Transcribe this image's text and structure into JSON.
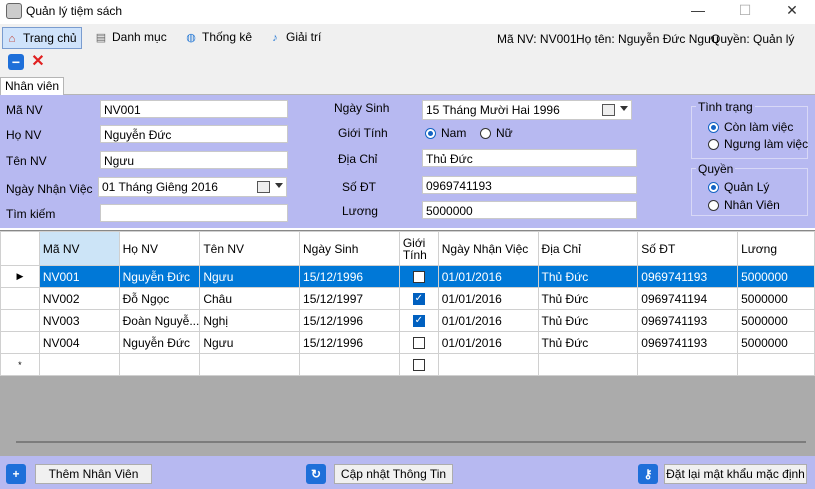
{
  "window": {
    "title": "Quản lý tiệm sách",
    "minimize": "—",
    "maximize": "☐",
    "close": "✕"
  },
  "menu": {
    "items": [
      {
        "label": "Trang chủ",
        "icon": "home-icon"
      },
      {
        "label": "Danh mục",
        "icon": "document-icon"
      },
      {
        "label": "Thống kê",
        "icon": "globe-icon"
      },
      {
        "label": "Giải trí",
        "icon": "music-note-icon"
      }
    ],
    "user": {
      "ma_nv": "Mã NV: NV001",
      "ho_ten": "Họ tên: Nguyễn Đức Ngưu",
      "quyen": "Quyền: Quản lý"
    }
  },
  "toolbar": {
    "minimize_glyph": "−",
    "close_glyph": "✕"
  },
  "tab": {
    "label": "Nhân viên"
  },
  "form": {
    "ma_nv": {
      "label": "Mã NV",
      "value": "NV001"
    },
    "ho_nv": {
      "label": "Họ NV",
      "value": "Nguyễn Đức"
    },
    "ten_nv": {
      "label": "Tên NV",
      "value": "Ngưu"
    },
    "ngay_nhan_viec": {
      "label": "Ngày Nhận Việc",
      "value": "01   Tháng Giêng   2016"
    },
    "tim_kiem": {
      "label": "Tìm kiếm",
      "value": ""
    },
    "ngay_sinh": {
      "label": "Ngày Sinh",
      "value": "15 Tháng Mười Hai 1996"
    },
    "gioi_tinh": {
      "label": "Giới Tính",
      "options": [
        "Nam",
        "Nữ"
      ],
      "selected": "Nam"
    },
    "dia_chi": {
      "label": "Địa Chỉ",
      "value": "Thủ Đức"
    },
    "so_dt": {
      "label": "Số ĐT",
      "value": "0969741193"
    },
    "luong": {
      "label": "Lương",
      "value": "5000000"
    },
    "tinh_trang": {
      "title": "Tình trạng",
      "options": [
        "Còn làm việc",
        "Ngưng làm việc"
      ],
      "selected": "Còn làm việc"
    },
    "quyen": {
      "title": "Quyền",
      "options": [
        "Quản Lý",
        "Nhân Viên"
      ],
      "selected": "Quản Lý"
    }
  },
  "table": {
    "columns": [
      "Mã NV",
      "Họ NV",
      "Tên NV",
      "Ngày Sinh",
      "Giới Tính",
      "Ngày Nhận Việc",
      "Địa Chỉ",
      "Số ĐT",
      "Lương"
    ],
    "rows": [
      {
        "ma": "NV001",
        "ho": "Nguyễn Đức",
        "ten": "Ngưu",
        "ngay_sinh": "15/12/1996",
        "gioi_tinh": false,
        "ngay_nv": "01/01/2016",
        "dia_chi": "Thủ Đức",
        "sdt": "0969741193",
        "luong": "5000000",
        "selected": true
      },
      {
        "ma": "NV002",
        "ho": "Đỗ Ngọc",
        "ten": "Châu",
        "ngay_sinh": "15/12/1997",
        "gioi_tinh": true,
        "ngay_nv": "01/01/2016",
        "dia_chi": "Thủ Đức",
        "sdt": "0969741194",
        "luong": "5000000",
        "selected": false
      },
      {
        "ma": "NV003",
        "ho": "Đoàn Nguyễ...",
        "ten": "Nghị",
        "ngay_sinh": "15/12/1996",
        "gioi_tinh": true,
        "ngay_nv": "01/01/2016",
        "dia_chi": "Thủ Đức",
        "sdt": "0969741193",
        "luong": "5000000",
        "selected": false
      },
      {
        "ma": "NV004",
        "ho": "Nguyễn Đức",
        "ten": "Ngưu",
        "ngay_sinh": "15/12/1996",
        "gioi_tinh": false,
        "ngay_nv": "01/01/2016",
        "dia_chi": "Thủ Đức",
        "sdt": "0969741193",
        "luong": "5000000",
        "selected": false
      }
    ],
    "current_row_marker": "▶",
    "new_row_marker": "*"
  },
  "buttons": {
    "add": {
      "label": "Thêm Nhân Viên",
      "icon": "+"
    },
    "update": {
      "label": "Cập nhật Thông Tin",
      "icon": "↻"
    },
    "reset_password": {
      "label": "Đặt lại mật khẩu mặc định",
      "icon": "⚷"
    }
  }
}
